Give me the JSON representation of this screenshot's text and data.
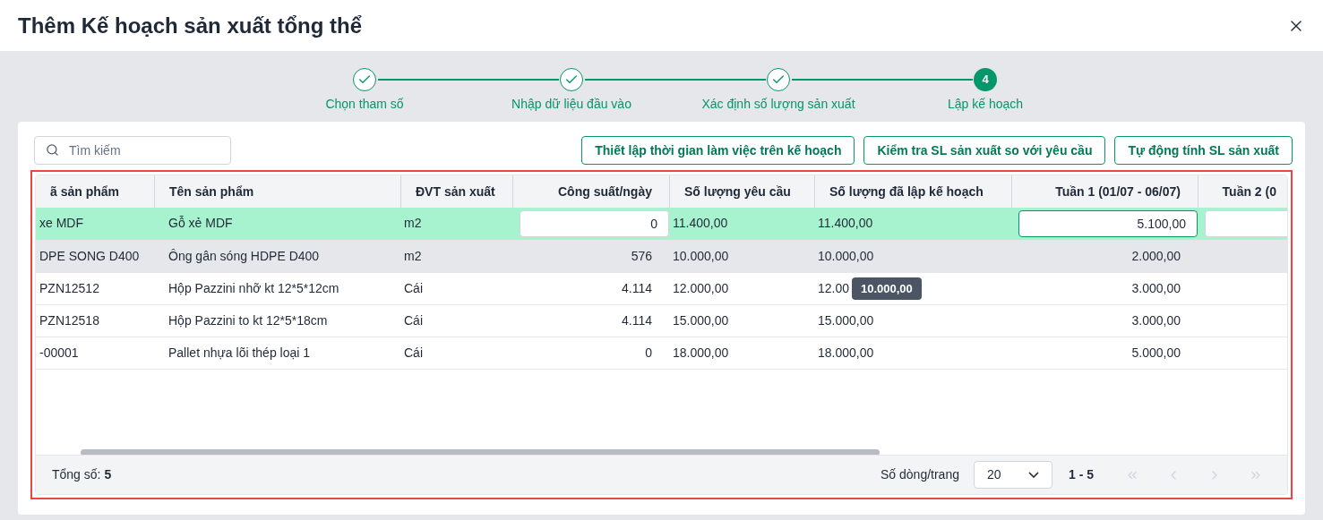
{
  "dialog": {
    "title": "Thêm Kế hoạch sản xuất tổng thể"
  },
  "steps": [
    {
      "label": "Chọn tham số",
      "completed": true
    },
    {
      "label": "Nhập dữ liệu đầu vào",
      "completed": true
    },
    {
      "label": "Xác định số lượng sản xuất",
      "completed": true
    },
    {
      "label": "Lập kế hoạch",
      "completed": false,
      "number": "4"
    }
  ],
  "search": {
    "placeholder": "Tìm kiếm"
  },
  "actions": [
    "Thiết lập thời gian làm việc trên kế hoạch",
    "Kiểm tra SL sản xuất so với yêu cầu",
    "Tự động tính SL sản xuất"
  ],
  "table": {
    "columns": [
      "ã sản phẩm",
      "Tên sản phẩm",
      "ĐVT sản xuất",
      "Công suất/ngày",
      "Số lượng yêu cầu",
      "Số lượng đã lập kế hoạch",
      "Tuần 1 (01/07 - 06/07)",
      "Tuần 2 (0"
    ],
    "rows": [
      {
        "selected": true,
        "hovered": false,
        "editing": true,
        "cells": [
          "xe MDF",
          "Gỗ xẻ MDF",
          "m2",
          "0",
          "11.400,00",
          "11.400,00",
          "5.100,00",
          ""
        ]
      },
      {
        "selected": false,
        "hovered": true,
        "editing": false,
        "cells": [
          "DPE SONG D400",
          "Ông gân sóng HDPE D400",
          "m2",
          "576",
          "10.000,00",
          "10.000,00",
          "2.000,00",
          ""
        ]
      },
      {
        "selected": false,
        "hovered": false,
        "editing": false,
        "cells": [
          "PZN12512",
          "Hộp Pazzini nhỡ kt 12*5*12cm",
          "Cái",
          "4.114",
          "12.000,00",
          "12.00",
          "3.000,00",
          ""
        ],
        "tooltip": "10.000,00"
      },
      {
        "selected": false,
        "hovered": false,
        "editing": false,
        "cells": [
          "PZN12518",
          "Hộp Pazzini to kt 12*5*18cm",
          "Cái",
          "4.114",
          "15.000,00",
          "15.000,00",
          "3.000,00",
          ""
        ]
      },
      {
        "selected": false,
        "hovered": false,
        "editing": false,
        "cells": [
          "-00001",
          "Pallet nhựa lõi thép loại 1",
          "Cái",
          "0",
          "18.000,00",
          "18.000,00",
          "5.000,00",
          ""
        ]
      }
    ]
  },
  "footer": {
    "total": "Tổng số: **5**",
    "page_size_label": "Số dòng/trang",
    "page_size": "20",
    "range": "1 - 5",
    "pager_disabled": true
  }
}
